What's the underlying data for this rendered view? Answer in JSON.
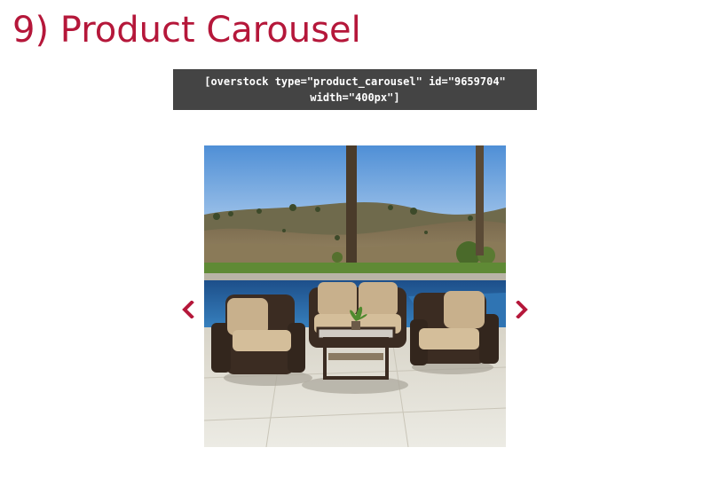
{
  "page": {
    "heading": "9) Product Carousel"
  },
  "shortcode": {
    "text": "[overstock type=\"product_carousel\" id=\"9659704\" width=\"400px\"]"
  },
  "carousel": {
    "image_icon": "patio-furniture-photo",
    "prev_icon": "chevron-left-icon",
    "next_icon": "chevron-right-icon",
    "accent_color": "#b5173a"
  },
  "colors": {
    "heading": "#b5173a",
    "code_background": "#444444",
    "code_text": "#ffffff"
  }
}
